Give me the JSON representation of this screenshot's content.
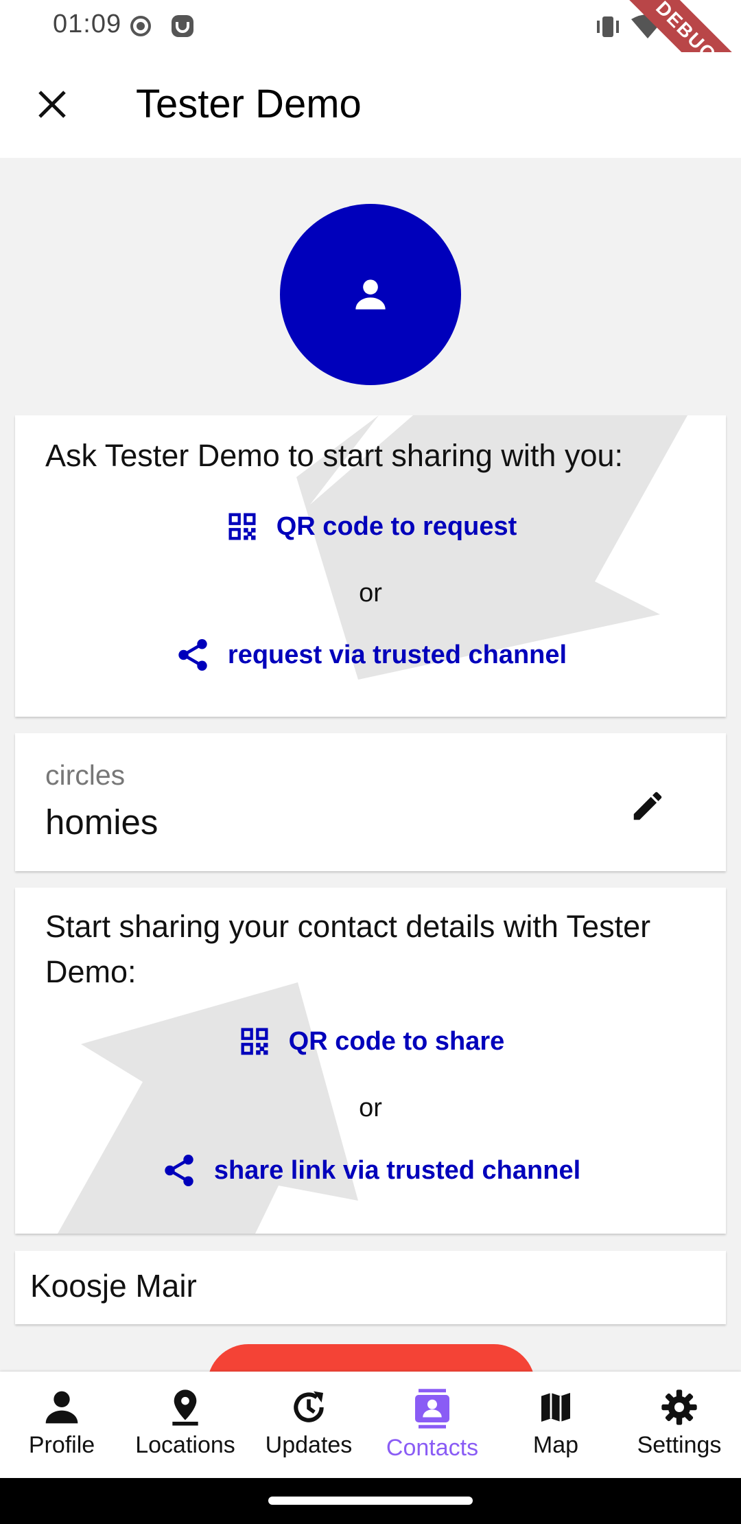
{
  "status_bar": {
    "time": "01:09",
    "left_icons": [
      "record-icon",
      "app-notification-icon"
    ],
    "right_icons": [
      "vibrate-icon",
      "wifi-icon",
      "battery-icon"
    ],
    "debug_banner": "DEBUG"
  },
  "app_bar": {
    "title": "Tester Demo",
    "close_icon": "close-icon"
  },
  "avatar": {
    "icon": "person-icon",
    "color": "#0000bb"
  },
  "request_card": {
    "heading": "Ask Tester Demo to start sharing with you:",
    "qr_action": "QR code to request",
    "or_text": "or",
    "channel_action": "request via trusted channel"
  },
  "circles_card": {
    "label": "circles",
    "value": "homies",
    "edit_icon": "edit-icon"
  },
  "share_card": {
    "heading": "Start sharing your contact details with Tester Demo:",
    "qr_action": "QR code to share",
    "or_text": "or",
    "channel_action": "share link via trusted channel"
  },
  "contact_card": {
    "name": "Koosje Mair"
  },
  "bottom_nav": {
    "items": [
      {
        "label": "Profile",
        "icon": "person-icon"
      },
      {
        "label": "Locations",
        "icon": "location-pin-icon"
      },
      {
        "label": "Updates",
        "icon": "update-icon"
      },
      {
        "label": "Contacts",
        "icon": "contacts-icon"
      },
      {
        "label": "Map",
        "icon": "map-icon"
      },
      {
        "label": "Settings",
        "icon": "gear-icon"
      }
    ],
    "active": "Contacts"
  },
  "colors": {
    "accent": "#0000bb",
    "active_nav": "#8a5cf5",
    "danger": "#f44336",
    "background": "#f2f2f2"
  }
}
